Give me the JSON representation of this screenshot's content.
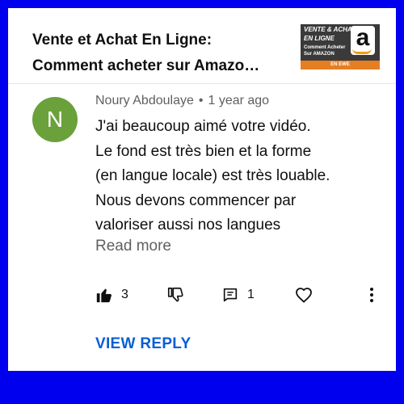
{
  "video": {
    "title_line1": "Vente et Achat En Ligne:",
    "title_line2": "Comment acheter sur Amazo…",
    "thumbnail": {
      "line1": "VENTE & ACHAT",
      "line2": "EN LIGNE",
      "line3": "Comment Acheter",
      "line4": "Sur AMAZON",
      "strip": "EN EWE",
      "logo": "a"
    }
  },
  "comment": {
    "avatar_letter": "N",
    "avatar_color": "#6aa13a",
    "author": "Noury Abdoulaye",
    "separator": "•",
    "time": "1 year ago",
    "lines": [
      "J'ai beaucoup aimé votre vidéo.",
      "Le fond est très bien et la forme",
      "(en langue locale) est très louable.",
      "Nous devons commencer par",
      "valoriser aussi nos langues"
    ],
    "read_more": "Read more"
  },
  "actions": {
    "like_count": "3",
    "reply_count": "1",
    "icons": [
      "thumbs-up-icon",
      "thumbs-down-icon",
      "reply-icon",
      "heart-icon",
      "more-icon"
    ]
  },
  "view_reply": "VIEW REPLY",
  "colors": {
    "frame": "#0000ee",
    "link": "#065fd4",
    "muted": "#606060"
  }
}
